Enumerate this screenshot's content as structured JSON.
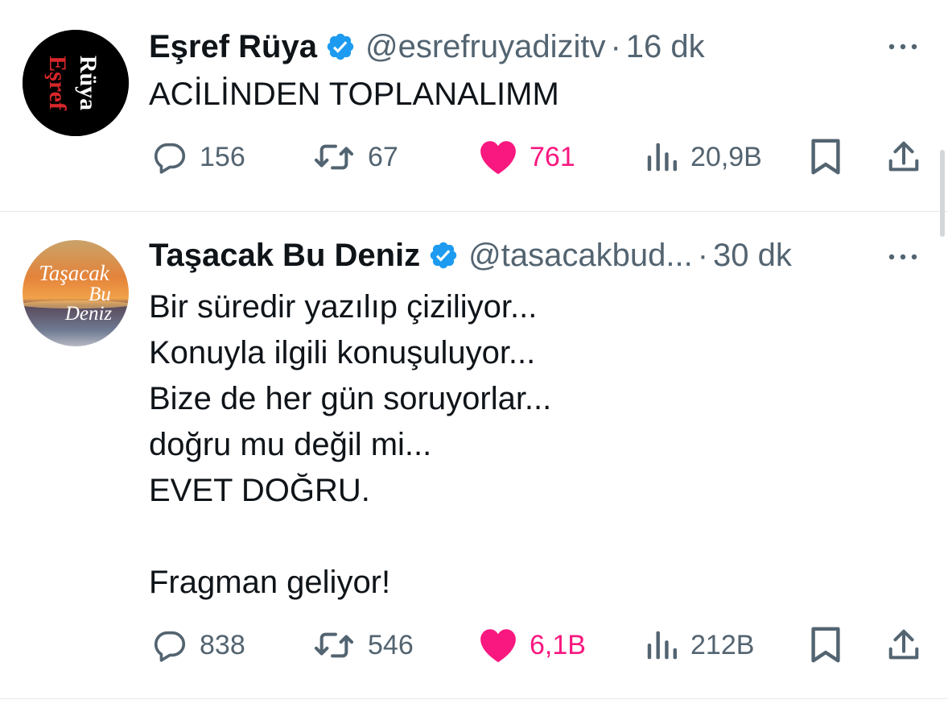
{
  "tweets": [
    {
      "author_name": "Eşref Rüya",
      "handle": "@esrefruyadizitv",
      "separator": "·",
      "time": "16 dk",
      "avatar_lines": [
        "Eşref",
        "Rüya"
      ],
      "text_lines": [
        "ACİLİNDEN TOPLANALIMM"
      ],
      "replies": "156",
      "retweets": "67",
      "likes": "761",
      "views": "20,9B"
    },
    {
      "author_name": "Taşacak Bu Deniz",
      "handle": "@tasacakbud...",
      "separator": "·",
      "time": "30 dk",
      "avatar_lines": [
        "Taşacak",
        "Bu",
        "Deniz"
      ],
      "text_lines": [
        "Bir süredir yazılıp çiziliyor...",
        "Konuyla ilgili konuşuluyor...",
        "Bize de her gün soruyorlar...",
        "doğru mu değil mi...",
        "EVET DOĞRU.",
        "",
        "Fragman geliyor!"
      ],
      "replies": "838",
      "retweets": "546",
      "likes": "6,1B",
      "views": "212B"
    }
  ],
  "icons": {
    "verified": "verified-badge-icon",
    "more": "more-icon",
    "reply": "reply-icon",
    "retweet": "retweet-icon",
    "like": "heart-icon",
    "views": "views-icon",
    "bookmark": "bookmark-icon",
    "share": "share-icon"
  },
  "colors": {
    "text": "#0f1419",
    "secondary": "#536471",
    "verified": "#1d9bf0",
    "like": "#f91880",
    "divider": "#e7e9ea",
    "esref_red": "#d7262a"
  }
}
